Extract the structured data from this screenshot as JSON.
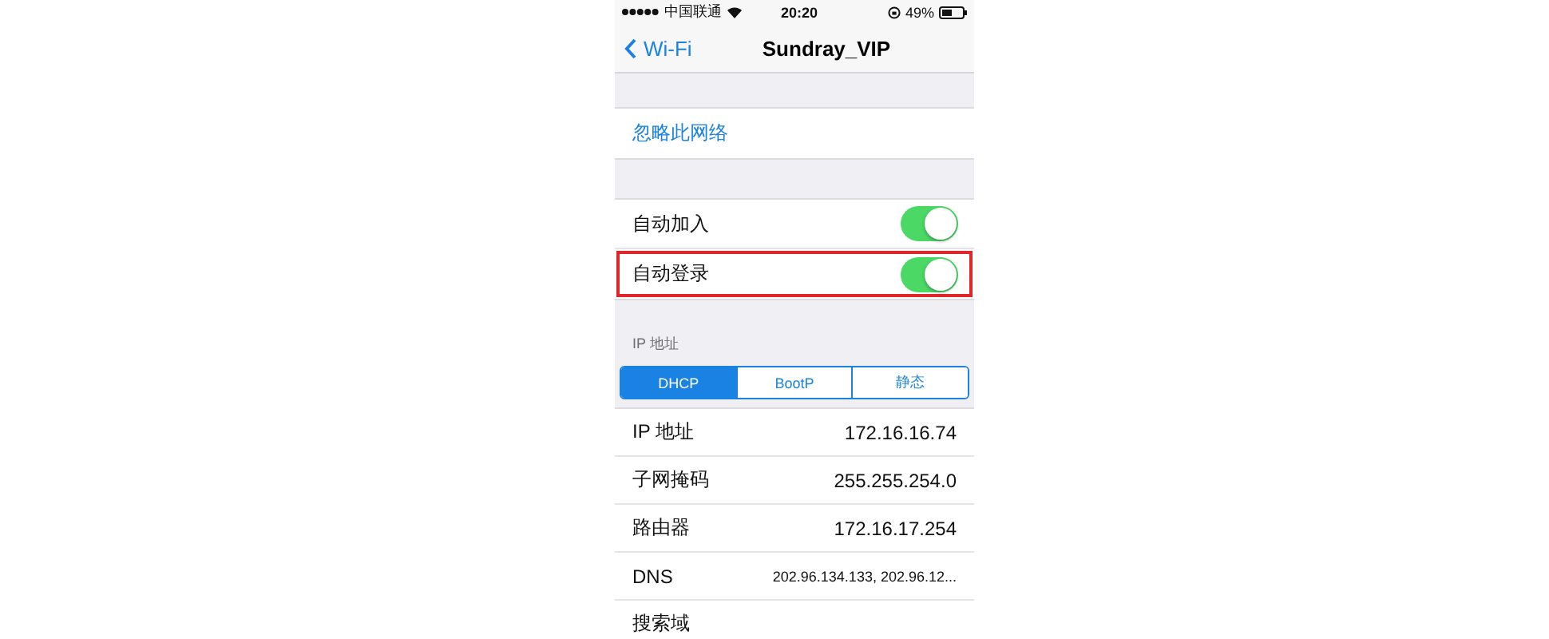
{
  "status_bar": {
    "carrier": "中国联通",
    "time": "20:20",
    "battery": "49%"
  },
  "nav": {
    "back": "Wi-Fi",
    "title": "Sundray_VIP"
  },
  "ignore_action": "忽略此网络",
  "toggles": [
    {
      "label": "自动加入",
      "on": true,
      "highlighted": false
    },
    {
      "label": "自动登录",
      "on": true,
      "highlighted": true
    }
  ],
  "ip_section": {
    "header": "IP 地址",
    "segments": [
      {
        "label": "DHCP",
        "selected": true
      },
      {
        "label": "BootP",
        "selected": false
      },
      {
        "label": "静态",
        "selected": false
      }
    ],
    "rows": [
      {
        "label": "IP 地址",
        "value": "172.16.16.74"
      },
      {
        "label": "子网掩码",
        "value": "255.255.254.0"
      },
      {
        "label": "路由器",
        "value": "172.16.17.254"
      },
      {
        "label": "DNS",
        "value": "202.96.134.133, 202.96.12..."
      },
      {
        "label": "搜索域",
        "value": ""
      }
    ]
  }
}
